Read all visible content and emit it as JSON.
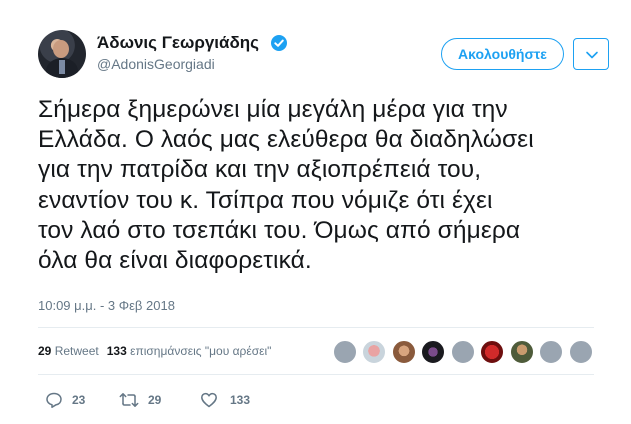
{
  "user": {
    "name": "Άδωνις Γεωργιάδης",
    "handle": "@AdonisGeorgiadi",
    "verified": true
  },
  "follow_button": {
    "label": "Ακολουθήστε"
  },
  "tweet": {
    "lines": [
      "Σήμερα ξημερώνει μία μεγάλη μέρα για την",
      "Ελλάδα. Ο λαός μας ελεύθερα θα διαδηλώσει",
      "για την πατρίδα και την αξιοπρέπειά του,",
      "εναντίον του κ. Τσίπρα που νόμιζε ότι έχει",
      "τον λαό στο τσεπάκι του. Όμως από σήμερα",
      "όλα θα είναι διαφορετικά."
    ],
    "timestamp": "10:09 μ.μ. - 3 Φεβ 2018"
  },
  "stats": {
    "retweets_count": "29",
    "retweets_label": "Retweet",
    "likes_count": "133",
    "likes_label": "επισημάνσεις \"μου αρέσει\""
  },
  "actions": {
    "reply_count": "23",
    "retweet_count": "29",
    "like_count": "133"
  },
  "colors": {
    "accent": "#1da1f2",
    "text": "#14171a",
    "secondary": "#657786",
    "divider": "#e6ecf0"
  }
}
